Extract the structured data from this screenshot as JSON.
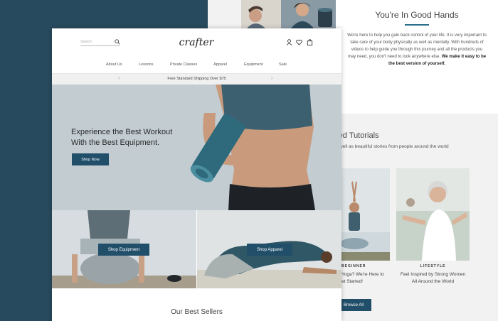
{
  "about": {
    "title": "You're In Good Hands",
    "text": "We're here to help you gain back control of your life. It is very important to take care of your body physically as well as mentally. With hundreds of videos to help guide you through this journey and all the products you may need, you don't need to look anywhere else.",
    "strong": "We make it easy to be the best version of yourself."
  },
  "tutorials": {
    "title": "red Tutorials",
    "subtitle": "s well as beautiful stories from people around the world",
    "cards": [
      {
        "tag": "BEGINNER",
        "caption_1": "Yoga? We're Here to",
        "caption_2": "et Started!"
      },
      {
        "tag": "LIFESTYLE",
        "caption_1": "Feel Inspired by Strong Women",
        "caption_2": "All Around the World"
      }
    ],
    "browse_label": "Browse All"
  },
  "header": {
    "search_placeholder": "Search",
    "logo_text": "crafter"
  },
  "nav": {
    "items": [
      "About Us",
      "Lessons",
      "Private Classes",
      "Apparel",
      "Equipment",
      "Sale"
    ]
  },
  "shipping": {
    "text": "Free Standard Shipping Over $75",
    "prev": "‹",
    "next": "›"
  },
  "hero": {
    "title_line1": "Experience the Best Workout",
    "title_line2": "With the Best Equipment.",
    "button": "Shop Now"
  },
  "tiles": {
    "equipment_button": "Shop Equipment",
    "apparel_button": "Shop Apparel"
  },
  "sellers": {
    "title": "Our Best Sellers"
  },
  "colors": {
    "navy": "#284a5e",
    "button": "#214e69",
    "accent": "#2a6f8a"
  }
}
